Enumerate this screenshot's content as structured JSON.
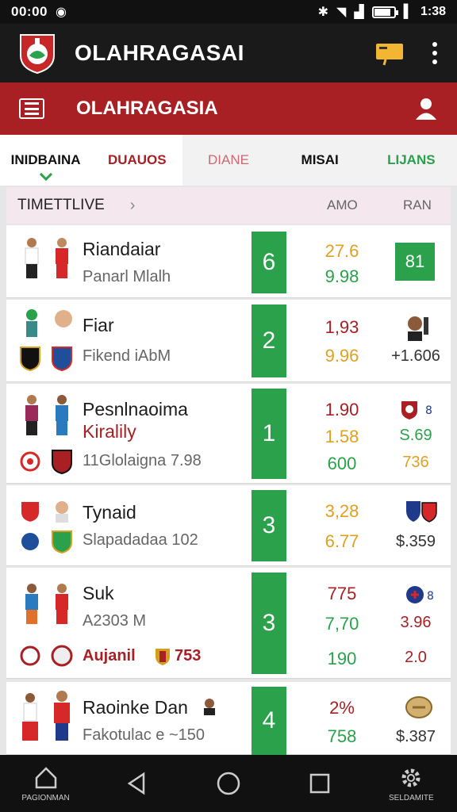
{
  "status": {
    "time": "00:00",
    "clock": "1:38"
  },
  "app": {
    "title": "OLAHRAGASAI"
  },
  "subheader": {
    "title": "OLAHRAGASIA"
  },
  "tabs": [
    {
      "label": "INIDBAINA"
    },
    {
      "label": "DUAUOS"
    },
    {
      "label": "DIANE"
    },
    {
      "label": "MISAI"
    },
    {
      "label": "LIJANS"
    }
  ],
  "list_header": {
    "label": "TIMETTLIVE",
    "col1": "AMO",
    "col2": "RAN"
  },
  "cards": [
    {
      "title": "Riandaiar",
      "subtitle": "Panarl Mlalh",
      "rank": "6",
      "odd1": "27.6",
      "odd2": "9.98",
      "right": "81"
    },
    {
      "title": "Fiar",
      "subtitle": "Fikend iAbM",
      "rank": "2",
      "odd1": "1,93",
      "odd2": "9.96",
      "right": "+1.606"
    },
    {
      "title": "Pesnlnaoima",
      "title2": "Kiralily",
      "subtitle": "11Glolaigna 7.98",
      "rank": "1",
      "odd1": "1.90",
      "odd2": "1.58",
      "odd3": "600",
      "right1": "S.69",
      "right2": "736"
    },
    {
      "title": "Tynaid",
      "subtitle": "Slapadadaa 102",
      "rank": "3",
      "odd1": "3,28",
      "odd2": "6.77",
      "right": "$.359"
    },
    {
      "title": "Suk",
      "subtitle": "A2303 M",
      "sub2a": "Aujanil",
      "sub2b": "753",
      "rank": "3",
      "odd1": "775",
      "odd2": "7,70",
      "odd3": "190",
      "right1": "3.96",
      "right2": "2.0"
    },
    {
      "title": "Raoinke Dan",
      "subtitle": "Fakotulac e ~150",
      "rank": "4",
      "odd1": "2%",
      "odd2": "758",
      "right": "$.387"
    }
  ],
  "nav": {
    "left_label": "PAGIONMAN",
    "right_label": "SELDAMITE"
  },
  "colors": {
    "appbar": "#1a1a1a",
    "brand_red": "#a81f24",
    "green": "#2aa14a",
    "orange": "#e0a020"
  }
}
